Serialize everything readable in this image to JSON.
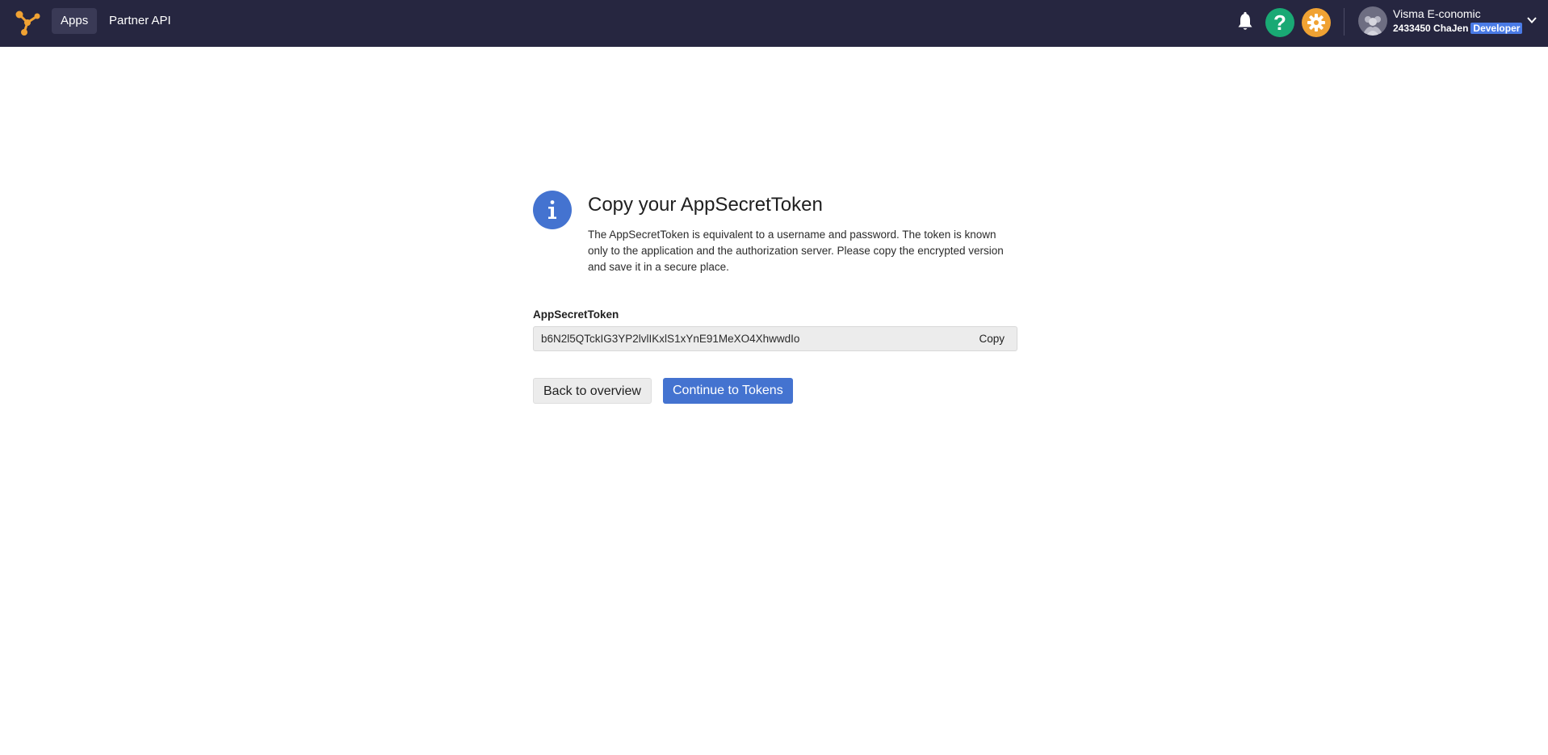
{
  "nav": {
    "items": [
      {
        "label": "Apps",
        "active": true
      },
      {
        "label": "Partner API",
        "active": false
      }
    ]
  },
  "header": {
    "icons": {
      "logo": "network-nodes-logo",
      "notifications": "bell-icon",
      "help": "question-icon",
      "settings": "gear-icon",
      "menu": "chevron-down-icon"
    },
    "help_symbol": "?",
    "user": {
      "name": "Visma E-conomic",
      "account": "2433450 ChaJen",
      "badge": "Developer"
    }
  },
  "main": {
    "title": "Copy your AppSecretToken",
    "description": "The AppSecretToken is equivalent to a username and password. The token is known only to the application and the authorization server. Please copy the encrypted version and save it in a secure place.",
    "field_label": "AppSecretToken",
    "token_value": "b6N2l5QTckIG3YP2lvlIKxlS1xYnE91MeXO4XhwwdIo",
    "copy_label": "Copy",
    "back_label": "Back to overview",
    "continue_label": "Continue to Tokens"
  },
  "colors": {
    "topbar": "#262640",
    "accent": "#4473d0",
    "help": "#19a974",
    "settings": "#f0a233",
    "logo": "#f0a233"
  }
}
